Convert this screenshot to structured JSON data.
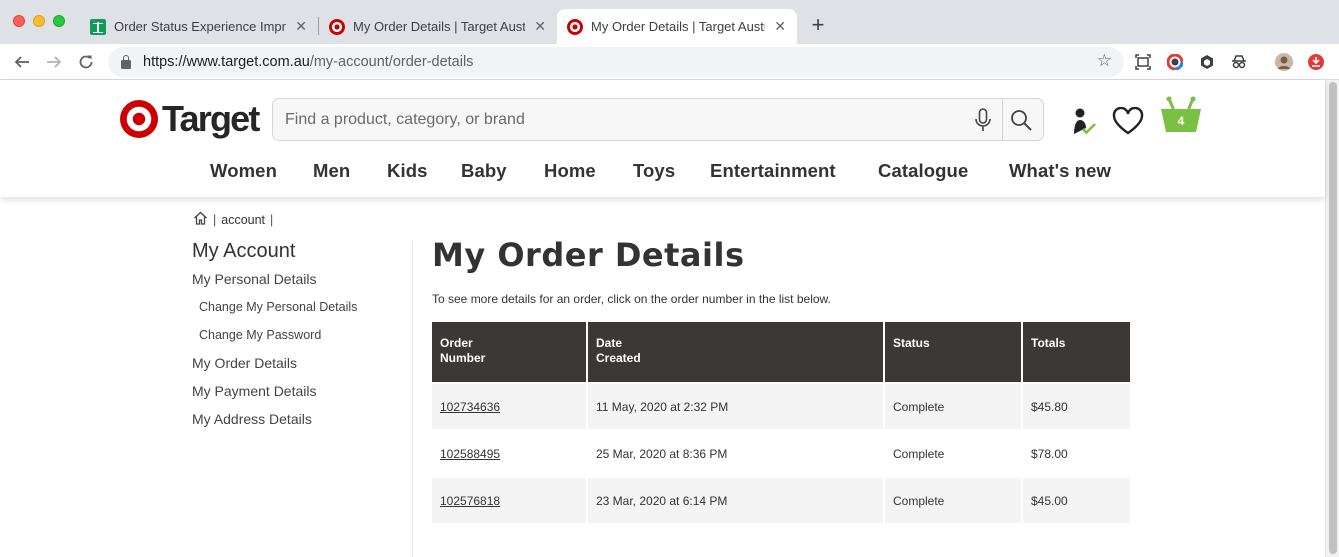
{
  "browser": {
    "tabs": [
      {
        "title": "Order Status Experience Impro",
        "favicon": "google-sheets-icon",
        "active": false
      },
      {
        "title": "My Order Details | Target Austr",
        "favicon": "target-icon",
        "active": false
      },
      {
        "title": "My Order Details | Target Austr",
        "favicon": "target-icon",
        "active": true
      }
    ],
    "url_host": "https://www.target.com.au",
    "url_path": "/my-account/order-details"
  },
  "header": {
    "brand": "Target",
    "search_placeholder": "Find a product, category, or brand",
    "basket_count": "4",
    "nav": [
      "Women",
      "Men",
      "Kids",
      "Baby",
      "Home",
      "Toys",
      "Entertainment",
      "Catalogue",
      "What's new"
    ]
  },
  "breadcrumb": {
    "home_icon": "home-icon",
    "items": [
      "account"
    ]
  },
  "sidebar": {
    "title": "My Account",
    "links": [
      {
        "label": "My Personal Details",
        "sub": false
      },
      {
        "label": "Change My Personal Details",
        "sub": true
      },
      {
        "label": "Change My Password",
        "sub": true
      },
      {
        "label": "My Order Details",
        "sub": false
      },
      {
        "label": "My Payment Details",
        "sub": false
      },
      {
        "label": "My Address Details",
        "sub": false
      }
    ]
  },
  "main": {
    "title": "My Order Details",
    "intro": "To see more details for an order, click on the order number in the list below.",
    "table": {
      "headers": [
        [
          "Order",
          "Number"
        ],
        [
          "Date",
          "Created"
        ],
        [
          "Status"
        ],
        [
          "Totals"
        ]
      ],
      "rows": [
        {
          "order": "102734636",
          "date": "11 May, 2020 at 2:32 PM",
          "status": "Complete",
          "total": "$45.80"
        },
        {
          "order": "102588495",
          "date": "25 Mar, 2020 at 8:36 PM",
          "status": "Complete",
          "total": "$78.00"
        },
        {
          "order": "102576818",
          "date": "23 Mar, 2020 at 6:14 PM",
          "status": "Complete",
          "total": "$45.00"
        }
      ]
    }
  },
  "colors": {
    "brand_red": "#cc0000",
    "table_header": "#3c3835",
    "basket_green": "#7ac143"
  }
}
